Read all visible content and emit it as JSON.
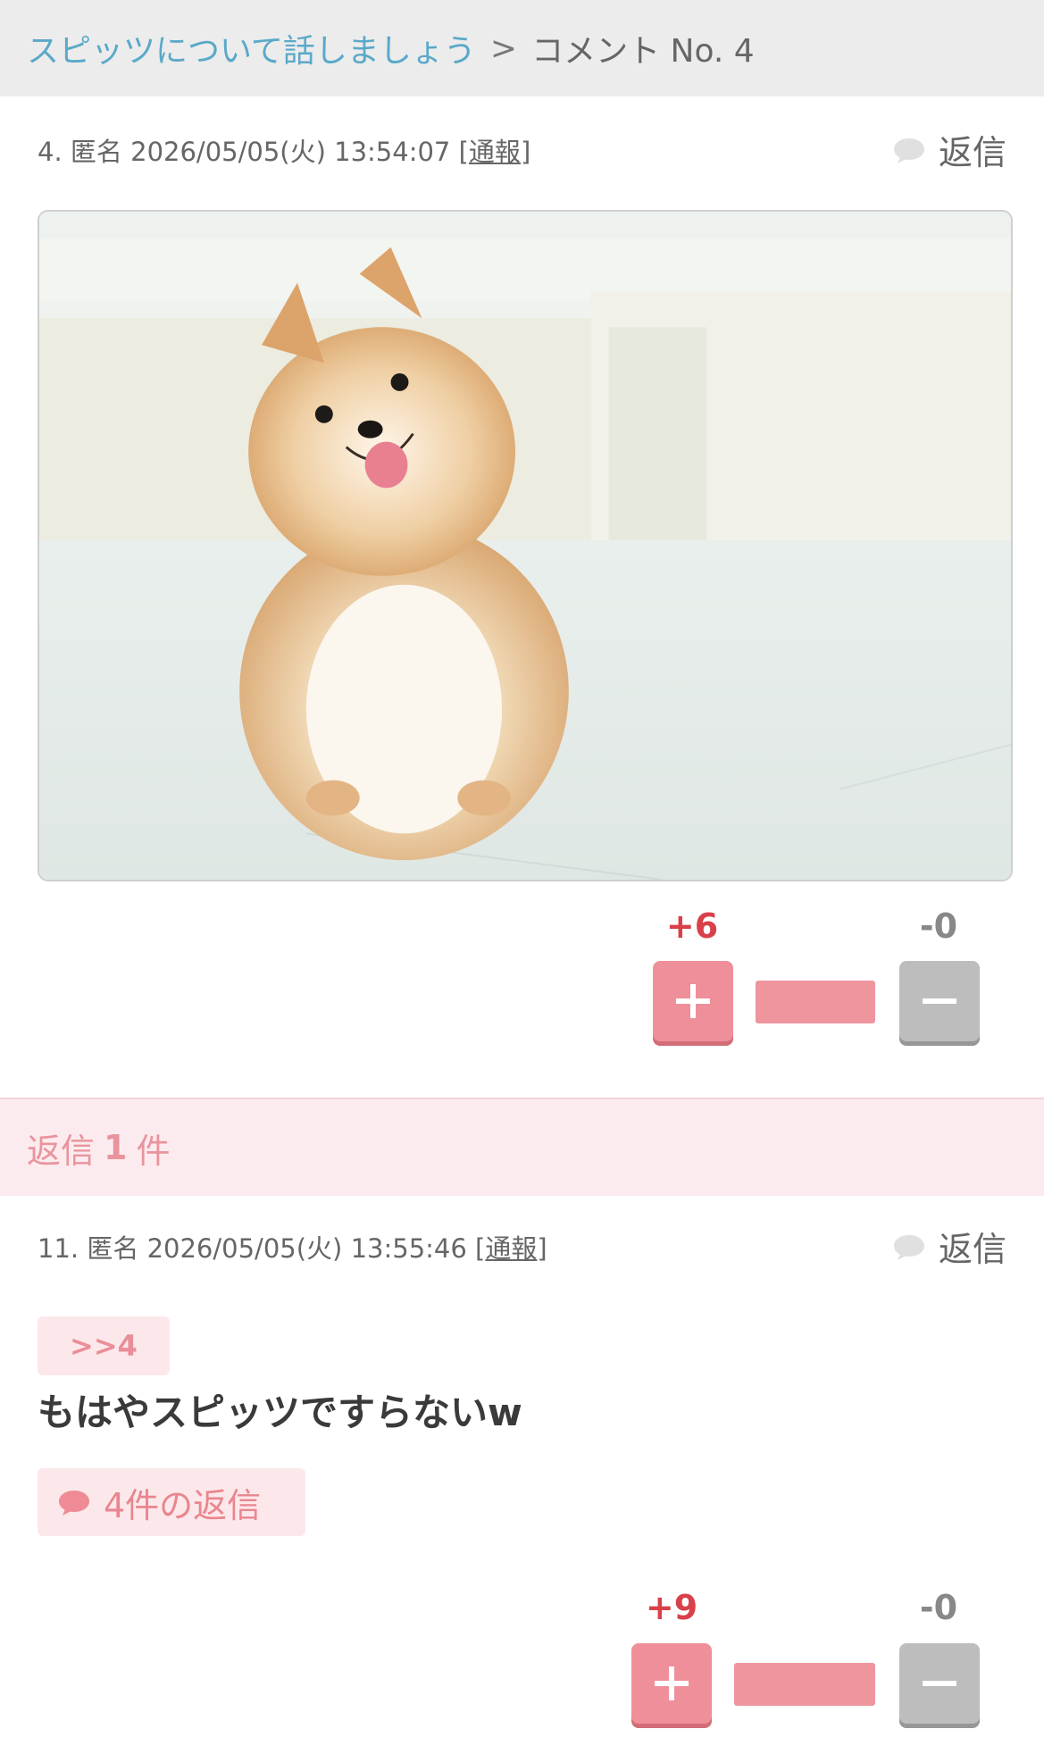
{
  "breadcrumb": {
    "topic": "スピッツについて話しましょう",
    "separator": ">",
    "current": "コメント No. 4"
  },
  "comment_main": {
    "number": "4.",
    "author": "匿名",
    "datetime": "2026/05/05(火) 13:54:07",
    "report_open": "[",
    "report_label": "通報",
    "report_close": "]",
    "reply_label": "返信",
    "image_alt": "Pomeranian sitting on a white floor",
    "votes": {
      "plus": "+6",
      "minus": "-0",
      "plus_ratio": 1.0
    }
  },
  "reply_band": {
    "prefix": "返信",
    "count": "1",
    "suffix": "件"
  },
  "comment_reply": {
    "number": "11.",
    "author": "匿名",
    "datetime": "2026/05/05(火) 13:55:46",
    "report_open": "[",
    "report_label": "通報",
    "report_close": "]",
    "reply_label": "返信",
    "anchor": ">>4",
    "body": "もはやスピッツですらないw",
    "replies_label": "4件の返信",
    "votes": {
      "plus": "+9",
      "minus": "-0",
      "plus_ratio": 1.0
    }
  },
  "colors": {
    "accent_pink": "#ef8f99",
    "link_blue": "#5aa9c8",
    "plus_red": "#d9414a"
  }
}
